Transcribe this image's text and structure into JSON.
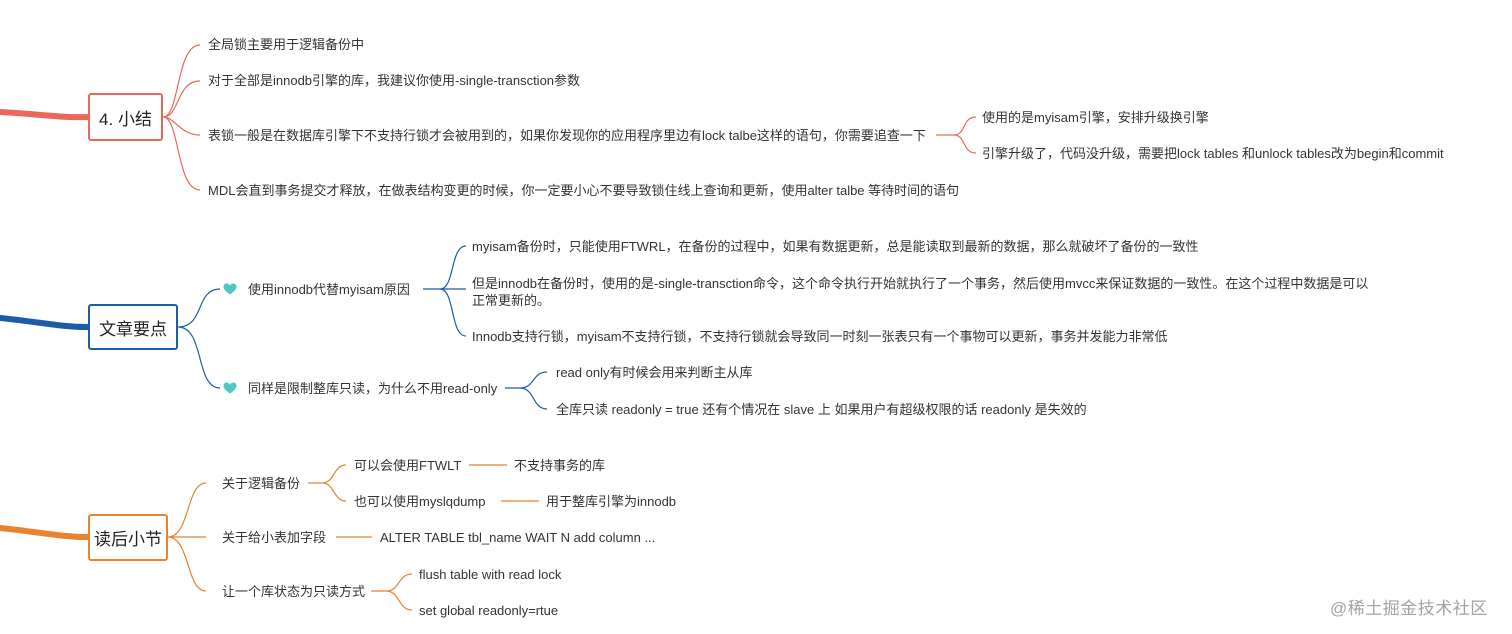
{
  "colors": {
    "section1": "#e8695a",
    "section2": "#1c5ea6",
    "section3": "#e8832f",
    "heart": "#4ec9c0"
  },
  "icons": [
    "heart-icon"
  ],
  "section1": {
    "title": "4. 小结",
    "items": [
      "全局锁主要用于逻辑备份中",
      "对于全部是innodb引擎的库，我建议你使用-single-transction参数",
      "表锁一般是在数据库引擎下不支持行锁才会被用到的，如果你发现你的应用程序里边有lock talbe这样的语句，你需要追查一下",
      "MDL会直到事务提交才释放，在做表结构变更的时候，你一定要小心不要导致锁住线上查询和更新，使用alter talbe 等待时间的语句"
    ],
    "sub_items": [
      "使用的是myisam引擎，安排升级换引擎",
      "引擎升级了，代码没升级，需要把lock tables 和unlock tables改为begin和commit"
    ]
  },
  "section2": {
    "title": "文章要点",
    "branch1": {
      "label": "使用innodb代替myisam原因",
      "items": [
        "myisam备份时，只能使用FTWRL，在备份的过程中，如果有数据更新，总是能读取到最新的数据，那么就破坏了备份的一致性",
        "但是innodb在备份时，使用的是-single-transction命令，这个命令执行开始就执行了一个事务，然后使用mvcc来保证数据的一致性。在这个过程中数据是可以正常更新的。",
        "Innodb支持行锁，myisam不支持行锁，不支持行锁就会导致同一时刻一张表只有一个事物可以更新，事务并发能力非常低"
      ]
    },
    "branch2": {
      "label": "同样是限制整库只读，为什么不用read-only",
      "items": [
        "read only有时候会用来判断主从库",
        "全库只读 readonly = true 还有个情况在 slave 上 如果用户有超级权限的话 readonly 是失效的"
      ]
    }
  },
  "section3": {
    "title": "读后小节",
    "branch1": {
      "label": "关于逻辑备份",
      "items": [
        {
          "text": "可以会使用FTWLT",
          "note": "不支持事务的库"
        },
        {
          "text": "也可以使用myslqdump",
          "note": "用于整库引擎为innodb"
        }
      ]
    },
    "branch2": {
      "label": "关于给小表加字段",
      "note": "ALTER TABLE tbl_name WAIT N add column ..."
    },
    "branch3": {
      "label": "让一个库状态为只读方式",
      "items": [
        "flush table with read lock",
        "set global readonly=rtue"
      ]
    }
  },
  "watermark": "@稀土掘金技术社区"
}
